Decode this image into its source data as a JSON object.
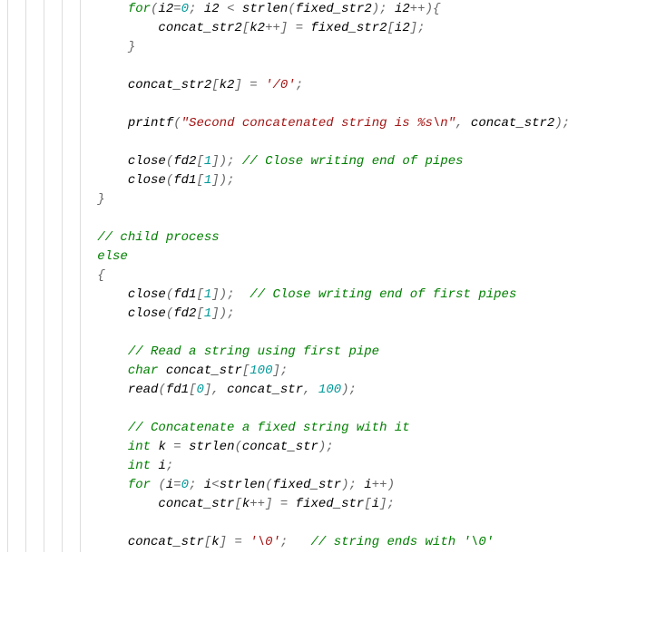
{
  "code": {
    "lines": [
      {
        "indent": 3,
        "tokens": [
          [
            "kw",
            "for"
          ],
          [
            "pn",
            "("
          ],
          [
            "",
            "i2"
          ],
          [
            "op",
            "="
          ],
          [
            "num",
            "0"
          ],
          [
            "pn",
            "; "
          ],
          [
            "",
            "i2 "
          ],
          [
            "op",
            "<"
          ],
          [
            "",
            " strlen"
          ],
          [
            "pn",
            "("
          ],
          [
            "",
            "fixed_str2"
          ],
          [
            "pn",
            "); "
          ],
          [
            "",
            "i2"
          ],
          [
            "op",
            "++"
          ],
          [
            "pn",
            "){"
          ]
        ]
      },
      {
        "indent": 4,
        "tokens": [
          [
            "",
            "concat_str2"
          ],
          [
            "pn",
            "["
          ],
          [
            "",
            "k2"
          ],
          [
            "op",
            "++"
          ],
          [
            "pn",
            "] "
          ],
          [
            "op",
            "="
          ],
          [
            "",
            " fixed_str2"
          ],
          [
            "pn",
            "["
          ],
          [
            "",
            "i2"
          ],
          [
            "pn",
            "];"
          ]
        ]
      },
      {
        "indent": 3,
        "tokens": [
          [
            "pn",
            "}"
          ]
        ]
      },
      {
        "indent": 0,
        "tokens": [
          [
            "",
            ""
          ]
        ]
      },
      {
        "indent": 3,
        "tokens": [
          [
            "",
            "concat_str2"
          ],
          [
            "pn",
            "["
          ],
          [
            "",
            "k2"
          ],
          [
            "pn",
            "] "
          ],
          [
            "op",
            "="
          ],
          [
            "",
            " "
          ],
          [
            "str",
            "'/0'"
          ],
          [
            "pn",
            ";"
          ]
        ]
      },
      {
        "indent": 0,
        "tokens": [
          [
            "",
            ""
          ]
        ]
      },
      {
        "indent": 3,
        "tokens": [
          [
            "",
            "printf"
          ],
          [
            "pn",
            "("
          ],
          [
            "str",
            "\"Second concatenated string is %s\\n\""
          ],
          [
            "pn",
            ", "
          ],
          [
            "",
            "concat_str2"
          ],
          [
            "pn",
            ");"
          ]
        ]
      },
      {
        "indent": 0,
        "tokens": [
          [
            "",
            ""
          ]
        ]
      },
      {
        "indent": 3,
        "tokens": [
          [
            "",
            "close"
          ],
          [
            "pn",
            "("
          ],
          [
            "",
            "fd2"
          ],
          [
            "pn",
            "["
          ],
          [
            "num",
            "1"
          ],
          [
            "pn",
            "]); "
          ],
          [
            "cmt",
            "// Close writing end of pipes"
          ]
        ]
      },
      {
        "indent": 3,
        "tokens": [
          [
            "",
            "close"
          ],
          [
            "pn",
            "("
          ],
          [
            "",
            "fd1"
          ],
          [
            "pn",
            "["
          ],
          [
            "num",
            "1"
          ],
          [
            "pn",
            "]);"
          ]
        ]
      },
      {
        "indent": 2,
        "tokens": [
          [
            "pn",
            "}"
          ]
        ]
      },
      {
        "indent": 0,
        "tokens": [
          [
            "",
            ""
          ]
        ]
      },
      {
        "indent": 2,
        "tokens": [
          [
            "cmt",
            "// child process"
          ]
        ]
      },
      {
        "indent": 2,
        "tokens": [
          [
            "kw",
            "else"
          ]
        ]
      },
      {
        "indent": 2,
        "tokens": [
          [
            "pn",
            "{"
          ]
        ]
      },
      {
        "indent": 3,
        "tokens": [
          [
            "",
            "close"
          ],
          [
            "pn",
            "("
          ],
          [
            "",
            "fd1"
          ],
          [
            "pn",
            "["
          ],
          [
            "num",
            "1"
          ],
          [
            "pn",
            "]);  "
          ],
          [
            "cmt",
            "// Close writing end of first pipes"
          ]
        ]
      },
      {
        "indent": 3,
        "tokens": [
          [
            "",
            "close"
          ],
          [
            "pn",
            "("
          ],
          [
            "",
            "fd2"
          ],
          [
            "pn",
            "["
          ],
          [
            "num",
            "1"
          ],
          [
            "pn",
            "]);"
          ]
        ]
      },
      {
        "indent": 0,
        "tokens": [
          [
            "",
            ""
          ]
        ]
      },
      {
        "indent": 3,
        "tokens": [
          [
            "cmt",
            "// Read a string using first pipe"
          ]
        ]
      },
      {
        "indent": 3,
        "tokens": [
          [
            "kw",
            "char"
          ],
          [
            "",
            " concat_str"
          ],
          [
            "pn",
            "["
          ],
          [
            "num",
            "100"
          ],
          [
            "pn",
            "];"
          ]
        ]
      },
      {
        "indent": 3,
        "tokens": [
          [
            "",
            "read"
          ],
          [
            "pn",
            "("
          ],
          [
            "",
            "fd1"
          ],
          [
            "pn",
            "["
          ],
          [
            "num",
            "0"
          ],
          [
            "pn",
            "], "
          ],
          [
            "",
            "concat_str"
          ],
          [
            "pn",
            ", "
          ],
          [
            "num",
            "100"
          ],
          [
            "pn",
            ");"
          ]
        ]
      },
      {
        "indent": 0,
        "tokens": [
          [
            "",
            ""
          ]
        ]
      },
      {
        "indent": 3,
        "tokens": [
          [
            "cmt",
            "// Concatenate a fixed string with it"
          ]
        ]
      },
      {
        "indent": 3,
        "tokens": [
          [
            "kw",
            "int"
          ],
          [
            "",
            " k "
          ],
          [
            "op",
            "="
          ],
          [
            "",
            " strlen"
          ],
          [
            "pn",
            "("
          ],
          [
            "",
            "concat_str"
          ],
          [
            "pn",
            ");"
          ]
        ]
      },
      {
        "indent": 3,
        "tokens": [
          [
            "kw",
            "int"
          ],
          [
            "",
            " i"
          ],
          [
            "pn",
            ";"
          ]
        ]
      },
      {
        "indent": 3,
        "tokens": [
          [
            "kw",
            "for"
          ],
          [
            "",
            " "
          ],
          [
            "pn",
            "("
          ],
          [
            "",
            "i"
          ],
          [
            "op",
            "="
          ],
          [
            "num",
            "0"
          ],
          [
            "pn",
            "; "
          ],
          [
            "",
            "i"
          ],
          [
            "op",
            "<"
          ],
          [
            "",
            "strlen"
          ],
          [
            "pn",
            "("
          ],
          [
            "",
            "fixed_str"
          ],
          [
            "pn",
            "); "
          ],
          [
            "",
            "i"
          ],
          [
            "op",
            "++"
          ],
          [
            "pn",
            ")"
          ]
        ]
      },
      {
        "indent": 4,
        "tokens": [
          [
            "",
            "concat_str"
          ],
          [
            "pn",
            "["
          ],
          [
            "",
            "k"
          ],
          [
            "op",
            "++"
          ],
          [
            "pn",
            "] "
          ],
          [
            "op",
            "="
          ],
          [
            "",
            " fixed_str"
          ],
          [
            "pn",
            "["
          ],
          [
            "",
            "i"
          ],
          [
            "pn",
            "];"
          ]
        ]
      },
      {
        "indent": 0,
        "tokens": [
          [
            "",
            ""
          ]
        ]
      },
      {
        "indent": 3,
        "tokens": [
          [
            "",
            "concat_str"
          ],
          [
            "pn",
            "["
          ],
          [
            "",
            "k"
          ],
          [
            "pn",
            "] "
          ],
          [
            "op",
            "="
          ],
          [
            "",
            " "
          ],
          [
            "str",
            "'\\0'"
          ],
          [
            "pn",
            ";   "
          ],
          [
            "cmt",
            "// string ends with '\\0'"
          ]
        ]
      }
    ]
  }
}
